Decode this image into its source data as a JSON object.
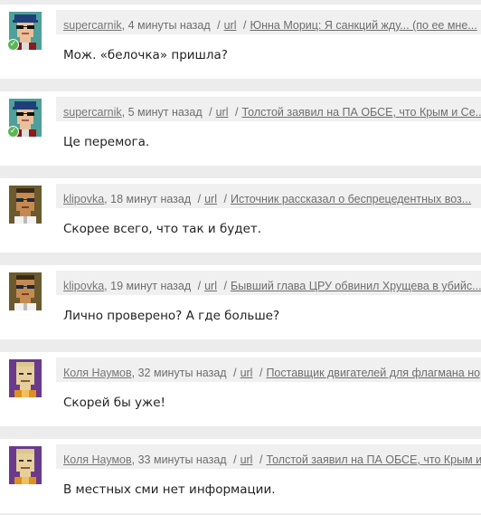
{
  "comments": [
    {
      "author": "supercarnik",
      "time": "4 минуты назад",
      "url_label": "url",
      "article": "Юнна Мориц: Я санкций жду... (по ее мне...",
      "text": "Мож. «белочка» пришла?",
      "avatar": "avatar-cap-sunglasses",
      "verified": true
    },
    {
      "author": "supercarnik",
      "time": "5 минут назад",
      "url_label": "url",
      "article": "Толстой заявил на ПА ОБСЕ, что Крым и Се...",
      "text": "Це перемога.",
      "avatar": "avatar-cap-sunglasses",
      "verified": true
    },
    {
      "author": "klipovka",
      "time": "18 минут назад",
      "url_label": "url",
      "article": "Источник рассказал о беспрецедентных воз...",
      "text": "Скорее всего, что так и будет.",
      "avatar": "avatar-glasses-tan",
      "verified": false
    },
    {
      "author": "klipovka",
      "time": "19 минут назад",
      "url_label": "url",
      "article": "Бывший глава ЦРУ обвинил Хрущева в убийс...",
      "text": "Лично проверено? А где больше?",
      "avatar": "avatar-glasses-tan",
      "verified": false
    },
    {
      "author": "Коля Наумов",
      "time": "32 минуты назад",
      "url_label": "url",
      "article": "Поставщик двигателей для флагмана нор",
      "text": "Скорей бы уже!",
      "avatar": "avatar-purple-blond",
      "verified": false
    },
    {
      "author": "Коля Наумов",
      "time": "33 минуты назад",
      "url_label": "url",
      "article": "Толстой заявил на ПА ОБСЕ, что Крым и С",
      "text": "В местных сми нет информации.",
      "avatar": "avatar-purple-blond",
      "verified": false
    }
  ],
  "separators": {
    "comma": ",",
    "slash": "/"
  },
  "colors": {
    "page_bg": "#ececec",
    "card_bg": "#ffffff",
    "meta_bg": "#f0f0f0",
    "verified_green": "#5bb55b"
  }
}
